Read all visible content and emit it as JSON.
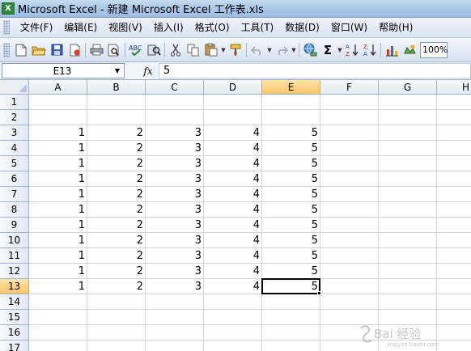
{
  "window": {
    "title": "Microsoft Excel - 新建 Microsoft Excel 工作表.xls",
    "app_icon_letter": "X"
  },
  "menu": {
    "items": [
      "文件(F)",
      "编辑(E)",
      "视图(V)",
      "插入(I)",
      "格式(O)",
      "工具(T)",
      "数据(D)",
      "窗口(W)",
      "帮助(H)"
    ]
  },
  "toolbar": {
    "zoom": "100%",
    "icons": [
      "new-icon",
      "open-icon",
      "save-icon",
      "permission-icon",
      "print-icon",
      "print-preview-icon",
      "spelling-icon",
      "research-icon",
      "cut-icon",
      "copy-icon",
      "paste-icon",
      "format-painter-icon",
      "undo-icon",
      "redo-icon",
      "hyperlink-icon",
      "autosum-icon",
      "sort-ascending-icon",
      "sort-descending-icon",
      "chart-wizard-icon",
      "drawing-icon"
    ]
  },
  "formula_bar": {
    "name_box": "E13",
    "fx_label": "fx",
    "value": "5"
  },
  "sheet": {
    "columns": [
      "A",
      "B",
      "C",
      "D",
      "E",
      "F",
      "G",
      "H"
    ],
    "active_column": "E",
    "row_numbers": [
      "1",
      "2",
      "3",
      "4",
      "5",
      "6",
      "7",
      "8",
      "9",
      "10",
      "11",
      "12",
      "13",
      "14",
      "15",
      "16",
      "17"
    ],
    "active_row": "13",
    "data_rows": [
      {
        "row": "3",
        "A": "1",
        "B": "2",
        "C": "3",
        "D": "4",
        "E": "5"
      },
      {
        "row": "4",
        "A": "1",
        "B": "2",
        "C": "3",
        "D": "4",
        "E": "5"
      },
      {
        "row": "5",
        "A": "1",
        "B": "2",
        "C": "3",
        "D": "4",
        "E": "5"
      },
      {
        "row": "6",
        "A": "1",
        "B": "2",
        "C": "3",
        "D": "4",
        "E": "5"
      },
      {
        "row": "7",
        "A": "1",
        "B": "2",
        "C": "3",
        "D": "4",
        "E": "5"
      },
      {
        "row": "8",
        "A": "1",
        "B": "2",
        "C": "3",
        "D": "4",
        "E": "5"
      },
      {
        "row": "9",
        "A": "1",
        "B": "2",
        "C": "3",
        "D": "4",
        "E": "5"
      },
      {
        "row": "10",
        "A": "1",
        "B": "2",
        "C": "3",
        "D": "4",
        "E": "5"
      },
      {
        "row": "11",
        "A": "1",
        "B": "2",
        "C": "3",
        "D": "4",
        "E": "5"
      },
      {
        "row": "12",
        "A": "1",
        "B": "2",
        "C": "3",
        "D": "4",
        "E": "5"
      },
      {
        "row": "13",
        "A": "1",
        "B": "2",
        "C": "3",
        "D": "4",
        "E": "5"
      }
    ],
    "selected_cell": "E13"
  },
  "watermark": {
    "text": "Bai 经验",
    "subtext": "jingyan.baidu.com"
  }
}
